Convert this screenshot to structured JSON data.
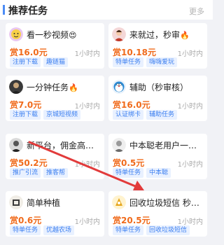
{
  "header": {
    "title": "推荐任务",
    "more": "更多"
  },
  "accent_color": "#4c8cf5",
  "reward_color": "#f06b1c",
  "arrow_color": "#e23b3b",
  "cards": [
    {
      "title": "看一秒视频",
      "emoji": "😍",
      "avatar": "face-avatar",
      "reward": "赏16.0元",
      "time": "1小时内",
      "tags": [
        "注册下载",
        "趣链猫"
      ]
    },
    {
      "title": "来就过，秒审",
      "emoji": "🔥",
      "avatar": "girl-avatar",
      "reward": "赏10.18元",
      "time": "1小时内",
      "tags": [
        "特单任务",
        "嗨嗨爱玩"
      ]
    },
    {
      "title": "一分钟任务",
      "emoji": "🔥",
      "avatar": "dark-avatar",
      "reward": "赏7.0元",
      "time": "1小时内",
      "tags": [
        "注册下载",
        "京城短视频"
      ]
    },
    {
      "title": "辅助（秒审核）",
      "emoji": "",
      "avatar": "doraemon-avatar",
      "reward": "赏16.0元",
      "time": "1小时内",
      "tags": [
        "认证绑卡",
        "辅助任务"
      ]
    },
    {
      "title": "新平台，佣金高，提...",
      "emoji": "",
      "avatar": "bw-avatar",
      "reward": "赏50.2元",
      "time": "1小时内",
      "tags": [
        "推广引流",
        "推客帮"
      ]
    },
    {
      "title": "中本聪老用户一张图...",
      "emoji": "",
      "avatar": "gray-avatar",
      "reward": "赏0.5元",
      "time": "1小时内",
      "tags": [
        "特单任务",
        "中本聪"
      ]
    },
    {
      "title": "简单种植",
      "emoji": "",
      "avatar": "plant-avatar",
      "reward": "赏0.6元",
      "time": "1小时内",
      "tags": [
        "特单任务",
        "优越农场"
      ]
    },
    {
      "title": "回收垃圾短信 秒审核",
      "emoji": "",
      "avatar": "gold-avatar",
      "reward": "赏20.5元",
      "time": "1小时内",
      "tags": [
        "特单任务",
        "回收垃圾短信"
      ]
    }
  ]
}
